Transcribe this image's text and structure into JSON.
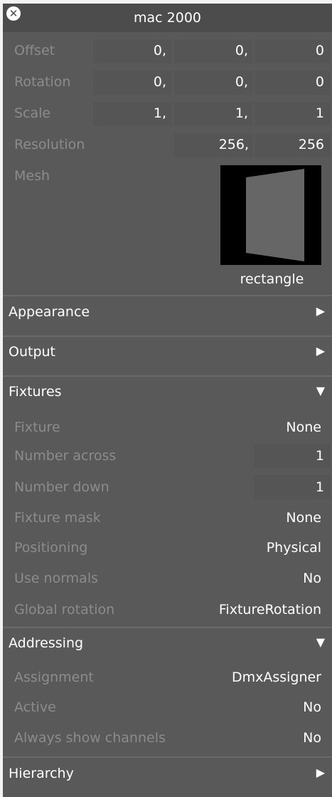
{
  "window": {
    "title": "mac 2000"
  },
  "transform": {
    "offset": {
      "label": "Offset",
      "x": "0",
      "y": "0",
      "z": "0"
    },
    "rotation": {
      "label": "Rotation",
      "x": "0",
      "y": "0",
      "z": "0"
    },
    "scale": {
      "label": "Scale",
      "x": "1",
      "y": "1",
      "z": "1"
    },
    "resolution": {
      "label": "Resolution",
      "x": "256",
      "y": "256"
    },
    "separator": ",",
    "mesh": {
      "label": "Mesh",
      "name": "rectangle"
    }
  },
  "sections": {
    "appearance": {
      "label": "Appearance",
      "expanded": false
    },
    "output": {
      "label": "Output",
      "expanded": false
    },
    "fixtures": {
      "label": "Fixtures",
      "expanded": true
    },
    "addressing": {
      "label": "Addressing",
      "expanded": true
    },
    "hierarchy": {
      "label": "Hierarchy",
      "expanded": false
    }
  },
  "arrows": {
    "collapsed": "▶",
    "expanded": "▼"
  },
  "fixtures": {
    "fixture": {
      "label": "Fixture",
      "value": "None"
    },
    "number_across": {
      "label": "Number across",
      "value": "1"
    },
    "number_down": {
      "label": "Number down",
      "value": "1"
    },
    "fixture_mask": {
      "label": "Fixture mask",
      "value": "None"
    },
    "positioning": {
      "label": "Positioning",
      "value": "Physical"
    },
    "use_normals": {
      "label": "Use normals",
      "value": "No"
    },
    "global_rotation": {
      "label": "Global rotation",
      "value": "FixtureRotation"
    }
  },
  "addressing": {
    "assignment": {
      "label": "Assignment",
      "value": "DmxAssigner"
    },
    "active": {
      "label": "Active",
      "value": "No"
    },
    "always_show_channels": {
      "label": "Always show channels",
      "value": "No"
    }
  },
  "icons": {
    "close": "close-icon",
    "collapsed": "triangle-right-icon",
    "expanded": "triangle-down-icon"
  },
  "colors": {
    "panel": "#595959",
    "title_bar": "#4c4c4c",
    "label": "#8c8c8c",
    "value": "#ffffff",
    "field": "#555555"
  }
}
